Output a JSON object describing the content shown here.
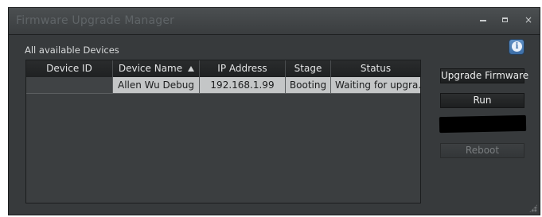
{
  "window": {
    "title": "Firmware Upgrade Manager",
    "controls": [
      "minimize",
      "maximize",
      "close"
    ],
    "close_glyph": "×"
  },
  "devices_section": {
    "label": "All available Devices",
    "info_icon_glyph": "i"
  },
  "table": {
    "columns": [
      "Device ID",
      "Device Name",
      "IP Address",
      "Stage",
      "Status"
    ],
    "sort_column": "Device Name",
    "sort_direction": "ascending",
    "rows": [
      {
        "device_id": "",
        "device_name": "Allen Wu Debug",
        "ip_address": "192.168.1.99",
        "stage": "Booting",
        "status": "Waiting for upgra..."
      }
    ]
  },
  "actions": {
    "upgrade_label": "Upgrade Firmware",
    "run_label": "Run",
    "reboot_label": "Reboot",
    "reboot_enabled": false
  },
  "colors": {
    "background": "#373a3c",
    "title_text": "#5f6467",
    "selected_row": "#c4c6c7",
    "info_accent": "#4a7db5"
  }
}
